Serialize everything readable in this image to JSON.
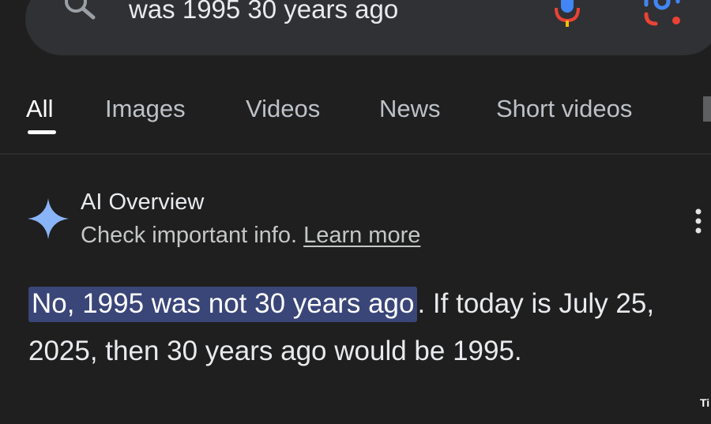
{
  "search": {
    "query": "was 1995 30 years ago",
    "icons": [
      "search-icon",
      "mic-icon",
      "lens-icon"
    ]
  },
  "tabs": [
    {
      "label": "All",
      "active": true
    },
    {
      "label": "Images"
    },
    {
      "label": "Videos"
    },
    {
      "label": "News"
    },
    {
      "label": "Short videos"
    }
  ],
  "ai_overview": {
    "title": "AI Overview",
    "subtitle": "Check important info.",
    "link": "Learn more",
    "answer_highlight": "No, 1995 was not 30 years ago",
    "answer_rest": ". If today is July 25, 2025, then 30 years ago would be 1995."
  },
  "colors": {
    "background": "#1f1f1f",
    "searchbar": "#303134",
    "highlight": "#3a4578",
    "sparkle": "#8ab4f8"
  }
}
